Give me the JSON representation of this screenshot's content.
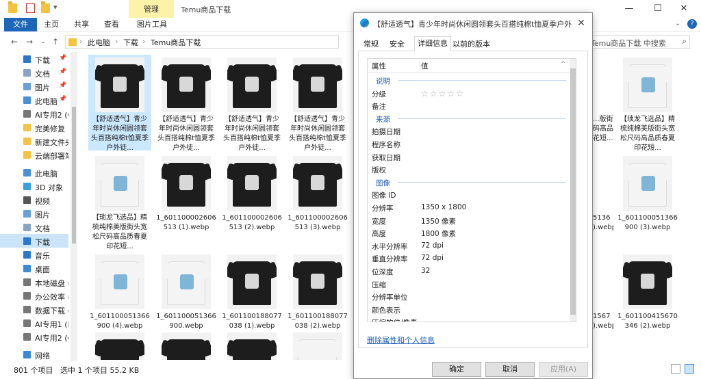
{
  "window": {
    "title": "Temu商品下载",
    "manage_tab": "管理",
    "controls": [
      "—",
      "☐",
      "✕"
    ]
  },
  "ribbon": {
    "tabs": [
      "文件",
      "主页",
      "共享",
      "查看",
      "图片工具"
    ]
  },
  "address": {
    "crumbs": [
      "此电脑",
      "下载",
      "Temu商品下载"
    ],
    "search_placeholder": "Temu商品下载 中搜索"
  },
  "sidebar": {
    "items": [
      {
        "label": "下载",
        "pinned": true,
        "color": "#2b78d0"
      },
      {
        "label": "文档",
        "pinned": true,
        "color": "#8aa4c8"
      },
      {
        "label": "图片",
        "pinned": true,
        "color": "#6aa0d8"
      },
      {
        "label": "此电脑",
        "pinned": true,
        "color": "#4a90d9"
      },
      {
        "label": "AI专用2 (G",
        "pinned": false,
        "color": "#777777"
      },
      {
        "label": "完美修复",
        "pinned": false,
        "color": "#f5c343"
      },
      {
        "label": "新建文件夹",
        "pinned": false,
        "color": "#f5c343"
      },
      {
        "label": "云端部署笔",
        "pinned": false,
        "color": "#f5c343"
      },
      {
        "label": "此电脑",
        "pinned": false,
        "color": "#4a90d9"
      },
      {
        "label": "3D 对象",
        "pinned": false,
        "color": "#3aa0e0"
      },
      {
        "label": "视频",
        "pinned": false,
        "color": "#555555"
      },
      {
        "label": "图片",
        "pinned": false,
        "color": "#6aa0d8"
      },
      {
        "label": "文档",
        "pinned": false,
        "color": "#8aa4c8"
      },
      {
        "label": "下载",
        "pinned": false,
        "color": "#2b78d0",
        "selected": true
      },
      {
        "label": "音乐",
        "pinned": false,
        "color": "#2b78d0"
      },
      {
        "label": "桌面",
        "pinned": false,
        "color": "#3a88d8"
      },
      {
        "label": "本地磁盘 (",
        "pinned": false,
        "color": "#777777"
      },
      {
        "label": "办公效率 (I",
        "pinned": false,
        "color": "#777777"
      },
      {
        "label": "数据下载 (",
        "pinned": false,
        "color": "#777777"
      },
      {
        "label": "AI专用1 (F",
        "pinned": false,
        "color": "#777777"
      },
      {
        "label": "AI专用2 (G",
        "pinned": false,
        "color": "#777777"
      },
      {
        "label": "网络",
        "pinned": false,
        "color": "#3a88d8"
      }
    ]
  },
  "files": {
    "row1": [
      {
        "name": "【舒适透气】青少年时尚休闲圆领套头百搭纯棉t恤夏季户外徒...",
        "style": "dark",
        "selected": true
      },
      {
        "name": "【舒适透气】青少年时尚休闲圆领套头百搭纯棉t恤夏季户外徒...",
        "style": "dark"
      },
      {
        "name": "【舒适透气】青少年时尚休闲圆领套头百搭纯棉t恤夏季户外徒...",
        "style": "dark"
      },
      {
        "name": "【舒适透气】青少年时尚休闲圆领套头百搭纯棉t恤夏季户外徒...",
        "style": "dark"
      }
    ],
    "row2": [
      {
        "name": "【琐龙飞选品】精梳纯棉美版街头宽松尺码高品质春夏印花短...",
        "style": "light"
      },
      {
        "name": "1_601100002606513 (1).webp",
        "style": "dark"
      },
      {
        "name": "1_601100002606513 (2).webp",
        "style": "dark"
      },
      {
        "name": "1_601100002606513 (3).webp",
        "style": "dark"
      }
    ],
    "row3": [
      {
        "name": "1_601100051366900 (4).webp",
        "style": "light"
      },
      {
        "name": "1_601100051366900.webp",
        "style": "light"
      },
      {
        "name": "1_601100188077038 (1).webp",
        "style": "dark"
      },
      {
        "name": "1_601100188077038 (2).webp",
        "style": "dark"
      }
    ],
    "right_col_a": [
      {
        "name": "...版街\n码高品\n花短..."
      },
      {
        "name": "5136\n).webp"
      },
      {
        "name": "1567\n).webp"
      }
    ],
    "right_col_b": [
      {
        "name": "【琐龙飞选品】精梳纯棉美版街头宽松尺码高品质春夏印花短...",
        "style": "light"
      },
      {
        "name": "1_601100051366900 (3).webp",
        "style": "light"
      },
      {
        "name": "1_601100415670346 (2).webp",
        "style": "dark"
      }
    ]
  },
  "dialog": {
    "title": "【舒适透气】青少年时尚休闲圆领套头百搭纯棉t恤夏季户外徒步...",
    "tabs": [
      "常规",
      "安全",
      "详细信息",
      "以前的版本"
    ],
    "active_tab": "详细信息",
    "header": {
      "key": "属性",
      "value": "值"
    },
    "rows": [
      {
        "type": "section",
        "label": "说明"
      },
      {
        "type": "prop",
        "key": "分级",
        "value": "☆☆☆☆☆",
        "rating": 0
      },
      {
        "type": "prop",
        "key": "备注",
        "value": ""
      },
      {
        "type": "section",
        "label": "来源"
      },
      {
        "type": "prop",
        "key": "拍摄日期",
        "value": ""
      },
      {
        "type": "prop",
        "key": "程序名称",
        "value": ""
      },
      {
        "type": "prop",
        "key": "获取日期",
        "value": ""
      },
      {
        "type": "prop",
        "key": "版权",
        "value": ""
      },
      {
        "type": "section",
        "label": "图像"
      },
      {
        "type": "prop",
        "key": "图像 ID",
        "value": ""
      },
      {
        "type": "prop",
        "key": "分辨率",
        "value": "1350 x 1800"
      },
      {
        "type": "prop",
        "key": "宽度",
        "value": "1350 像素"
      },
      {
        "type": "prop",
        "key": "高度",
        "value": "1800 像素"
      },
      {
        "type": "prop",
        "key": "水平分辨率",
        "value": "72 dpi"
      },
      {
        "type": "prop",
        "key": "垂直分辨率",
        "value": "72 dpi"
      },
      {
        "type": "prop",
        "key": "位深度",
        "value": "32"
      },
      {
        "type": "prop",
        "key": "压缩",
        "value": ""
      },
      {
        "type": "prop",
        "key": "分辨率单位",
        "value": ""
      },
      {
        "type": "prop",
        "key": "颜色表示",
        "value": ""
      },
      {
        "type": "prop",
        "key": "压缩的位/像素",
        "value": ""
      }
    ],
    "remove_link": "删除属性和个人信息",
    "buttons": {
      "ok": "确定",
      "cancel": "取消",
      "apply": "应用(A)"
    }
  },
  "status": {
    "count": "801 个项目",
    "selection": "选中 1 个项目  55.2 KB"
  }
}
